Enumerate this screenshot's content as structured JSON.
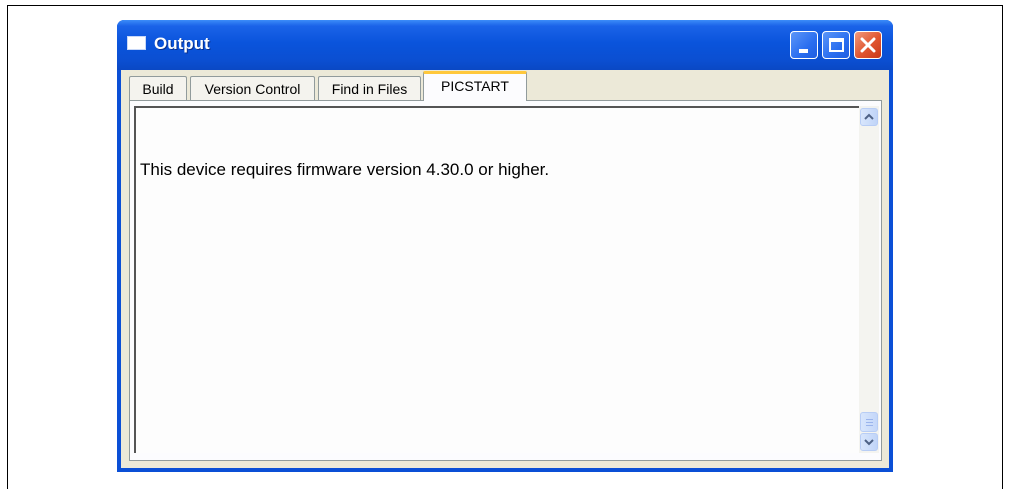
{
  "window": {
    "title": "Output",
    "icon": "window-app-icon",
    "controls": [
      "minimize-icon",
      "maximize-icon",
      "close-icon"
    ]
  },
  "tabs": [
    {
      "label": "Build",
      "active": false
    },
    {
      "label": "Version Control",
      "active": false
    },
    {
      "label": "Find in Files",
      "active": false
    },
    {
      "label": "PICSTART",
      "active": true
    }
  ],
  "output": {
    "lines": [
      "This device requires firmware version 4.30.0 or higher."
    ]
  },
  "colors": {
    "titlebar": "#0a54dc",
    "active_tab_accent": "#ffc83c",
    "close_button": "#e0552f"
  }
}
